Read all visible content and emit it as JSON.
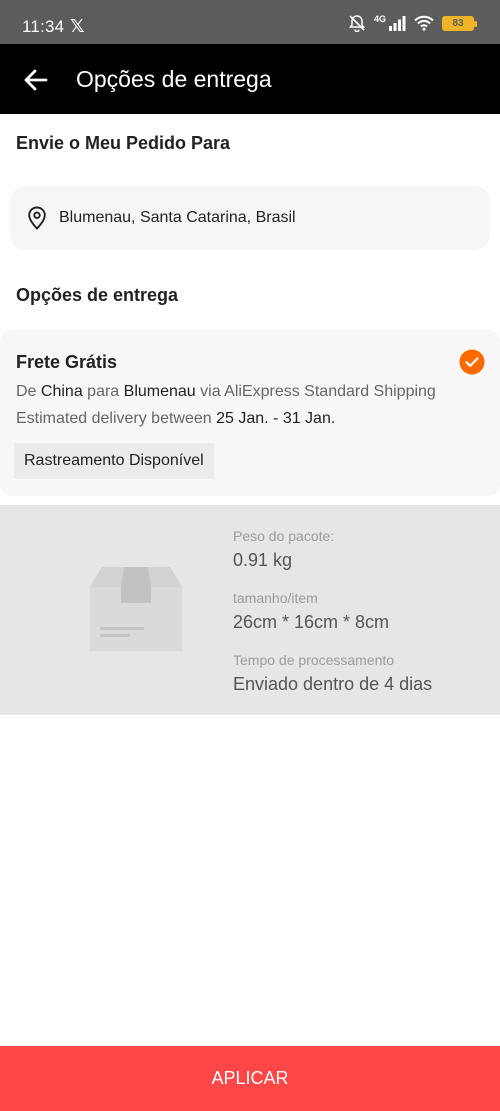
{
  "status_bar": {
    "time": "11:34",
    "notification_icon": "x-logo-icon",
    "network": "4G",
    "battery": "83",
    "icons": [
      "bell-off-icon",
      "signal-icon",
      "wifi-icon",
      "battery-icon"
    ]
  },
  "header": {
    "back_icon": "arrow-left-icon",
    "title": "Opções de entrega"
  },
  "ship_to": {
    "heading": "Envie o Meu Pedido Para",
    "pin_icon": "location-pin-icon",
    "address": "Blumenau, Santa Catarina, Brasil"
  },
  "delivery_options": {
    "heading": "Opções de entrega",
    "option": {
      "title": "Frete Grátis",
      "selected": true,
      "from_prefix": "De ",
      "from": "China",
      "to_prefix": " para ",
      "to": "Blumenau",
      "via": " via AliExpress Standard Shipping",
      "delivery_prefix": "Estimated delivery between ",
      "delivery_dates": "25 Jan. - 31 Jan.",
      "tracking": "Rastreamento Disponível"
    }
  },
  "package": {
    "icon": "package-box-icon",
    "weight_label": "Peso do pacote:",
    "weight_value": "0.91 kg",
    "size_label": "tamanho/item",
    "size_value": "26cm * 16cm * 8cm",
    "processing_label": "Tempo de processamento",
    "processing_value": "Enviado dentro de 4 dias"
  },
  "footer": {
    "apply_label": "APLICAR"
  },
  "colors": {
    "accent": "#ff6a00",
    "apply_button": "#ff4747",
    "header_bg": "#000000",
    "status_bar_bg": "#5c5c5c"
  }
}
